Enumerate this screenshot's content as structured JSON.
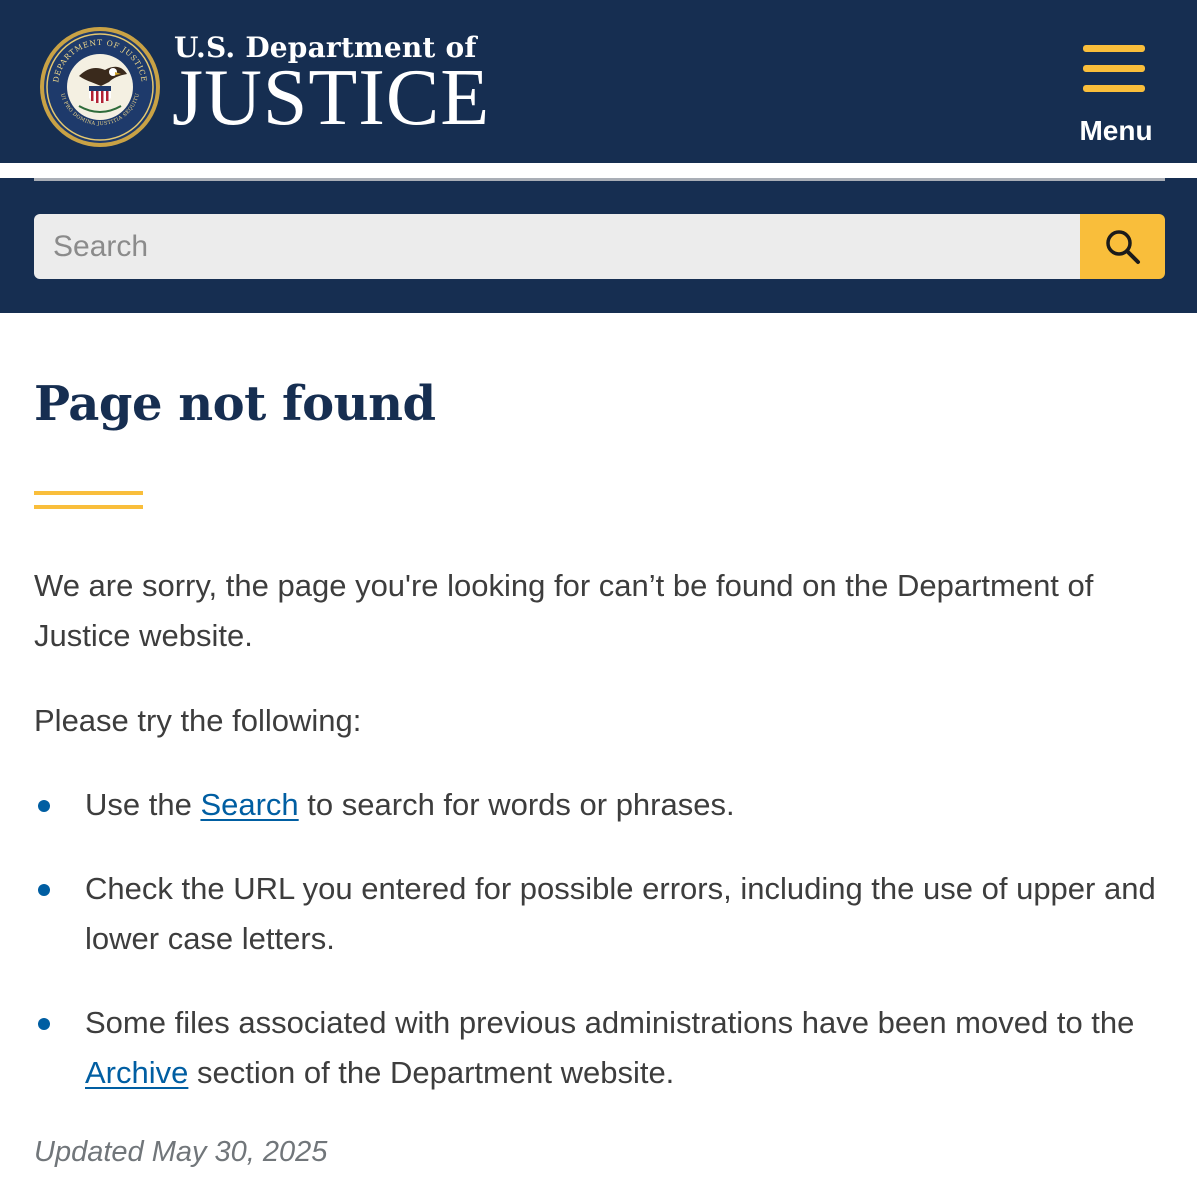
{
  "header": {
    "agency_line1": "U.S. Department of",
    "agency_line2": "JUSTICE",
    "seal_text_top": "DEPARTMENT OF JUSTICE",
    "seal_text_bottom": "QUI PRO DOMINA JUSTITIA SEQUITUR",
    "menu_label": "Menu"
  },
  "search": {
    "placeholder": "Search",
    "value": ""
  },
  "main": {
    "title": "Page not found",
    "intro": "We are sorry, the page you're looking for can’t be found on the Department of Justice website.",
    "try_heading": "Please try the following:",
    "bullets": [
      {
        "before": "Use the ",
        "link": "Search",
        "after": " to search for words or phrases."
      },
      {
        "text": "Check the URL you entered for possible errors, including the use of upper and lower case letters."
      },
      {
        "before": "Some files associated with previous administrations have been moved to the ",
        "link": "Archive",
        "after": " section of the Department website."
      }
    ],
    "updated": "Updated May 30, 2025"
  },
  "colors": {
    "navy": "#162e51",
    "gold": "#f9be3b",
    "link_blue": "#005ea2",
    "body_text": "#3d3d3d",
    "muted": "#71767a"
  },
  "icons": [
    "doj-seal",
    "hamburger-menu-icon",
    "search-icon",
    "bullet-dot"
  ]
}
